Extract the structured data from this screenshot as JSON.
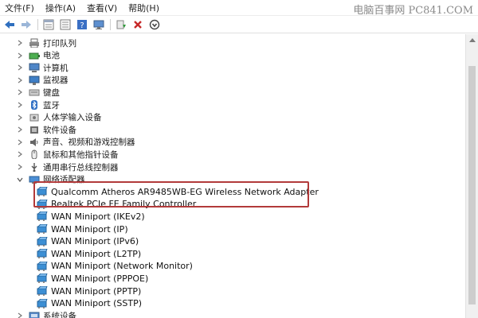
{
  "menubar": {
    "items": [
      "文件(F)",
      "操作(A)",
      "查看(V)",
      "帮助(H)"
    ],
    "watermark": "电脑百事网 PC841.COM"
  },
  "toolbar": {
    "icons": [
      "back-arrow-icon",
      "forward-arrow-icon",
      "properties-icon",
      "details-icon",
      "help-icon",
      "computer-icon",
      "update-driver-icon",
      "uninstall-x-icon",
      "disable-icon"
    ]
  },
  "tree": {
    "categories_top": [
      {
        "label": "打印队列",
        "icon": "printer-icon",
        "expanded": false
      },
      {
        "label": "电池",
        "icon": "battery-icon",
        "expanded": false
      },
      {
        "label": "计算机",
        "icon": "computer-icon",
        "expanded": false
      },
      {
        "label": "监视器",
        "icon": "monitor-icon",
        "expanded": false
      },
      {
        "label": "键盘",
        "icon": "keyboard-icon",
        "expanded": false
      },
      {
        "label": "蓝牙",
        "icon": "bluetooth-icon",
        "expanded": false
      },
      {
        "label": "人体学输入设备",
        "icon": "hid-icon",
        "expanded": false
      },
      {
        "label": "软件设备",
        "icon": "software-device-icon",
        "expanded": false
      },
      {
        "label": "声音、视频和游戏控制器",
        "icon": "speaker-icon",
        "expanded": false
      },
      {
        "label": "鼠标和其他指针设备",
        "icon": "mouse-icon",
        "expanded": false
      },
      {
        "label": "通用串行总线控制器",
        "icon": "usb-icon",
        "expanded": false
      }
    ],
    "network_category": {
      "label": "网络适配器",
      "icon": "network-adapter-icon",
      "expanded": true
    },
    "network_devices": [
      "Qualcomm Atheros AR9485WB-EG Wireless Network Adapter",
      "Realtek PCIe FE Family Controller",
      "WAN Miniport (IKEv2)",
      "WAN Miniport (IP)",
      "WAN Miniport (IPv6)",
      "WAN Miniport (L2TP)",
      "WAN Miniport (Network Monitor)",
      "WAN Miniport (PPPOE)",
      "WAN Miniport (PPTP)",
      "WAN Miniport (SSTP)"
    ],
    "categories_bottom": [
      {
        "label": "系统设备",
        "icon": "system-device-icon",
        "expanded": false
      }
    ]
  },
  "colors": {
    "highlight_border": "#b23a3a",
    "network_icon": "#3c8fd4"
  }
}
